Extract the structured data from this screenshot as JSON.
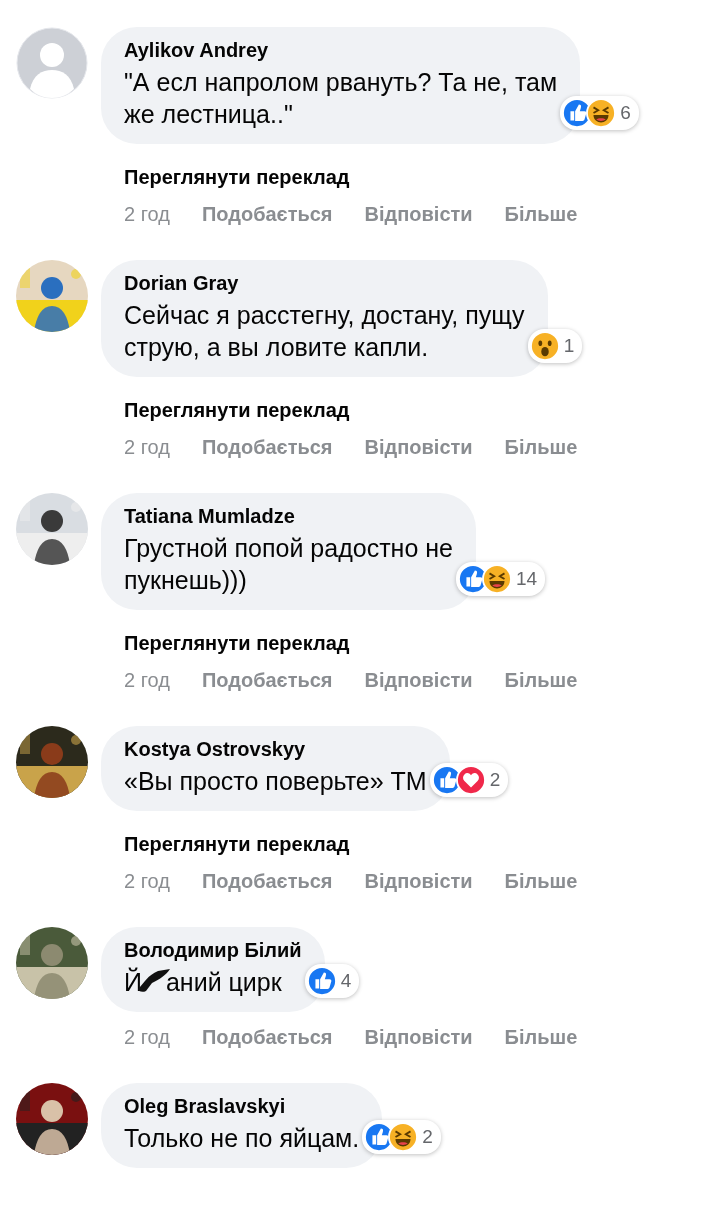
{
  "comments": [
    {
      "author": "Aylikov Andrey",
      "avatar": {
        "kind": "default"
      },
      "text_parts": [
        {
          "kind": "text",
          "text": "\"А есл напролом рвануть? Та не, там\nже лестница..\""
        }
      ],
      "reactions": [
        {
          "kind": "like"
        },
        {
          "kind": "haha"
        }
      ],
      "reaction_count": "6",
      "translate": "Переглянути переклад",
      "actions": [
        "2 год",
        "Подобається",
        "Відповісти",
        "Більше"
      ]
    },
    {
      "author": "Dorian Gray",
      "avatar": {
        "kind": "picture"
      },
      "text_parts": [
        {
          "kind": "text",
          "text": "Сейчас я расстегну, достану, пущу\nструю, а вы ловите капли."
        }
      ],
      "reactions": [
        {
          "kind": "wow"
        }
      ],
      "reaction_count": "1",
      "translate": "Переглянути переклад",
      "actions": [
        "2 год",
        "Подобається",
        "Відповісти",
        "Більше"
      ]
    },
    {
      "author": "Tatiana Mumladze",
      "avatar": {
        "kind": "picture"
      },
      "text_parts": [
        {
          "kind": "text",
          "text": "Грустной попой радостно не\nпукнешь)))"
        }
      ],
      "reactions": [
        {
          "kind": "like"
        },
        {
          "kind": "haha"
        }
      ],
      "reaction_count": "14",
      "translate": "Переглянути переклад",
      "actions": [
        "2 год",
        "Подобається",
        "Відповісти",
        "Більше"
      ]
    },
    {
      "author": "Kostya Ostrovskyy",
      "avatar": {
        "kind": "picture"
      },
      "text_parts": [
        {
          "kind": "text",
          "text": "«Вы просто поверьте» ТМ"
        }
      ],
      "reactions": [
        {
          "kind": "like"
        },
        {
          "kind": "love"
        }
      ],
      "reaction_count": "2",
      "translate": "Переглянути переклад",
      "actions": [
        "2 год",
        "Подобається",
        "Відповісти",
        "Більше"
      ]
    },
    {
      "author": "Володимир Білий",
      "avatar": {
        "kind": "picture"
      },
      "text_parts": [
        {
          "kind": "text",
          "text": "Й"
        },
        {
          "kind": "censor"
        },
        {
          "kind": "text",
          "text": "аний цирк"
        }
      ],
      "reactions": [
        {
          "kind": "like"
        }
      ],
      "reaction_count": "4",
      "actions": [
        "2 год",
        "Подобається",
        "Відповісти",
        "Більше"
      ]
    },
    {
      "author": "Oleg Braslavskyi",
      "avatar": {
        "kind": "picture"
      },
      "text_parts": [
        {
          "kind": "text",
          "text": "Только не по яйцам."
        }
      ],
      "reactions": [
        {
          "kind": "like"
        },
        {
          "kind": "haha"
        }
      ],
      "reaction_count": "2"
    }
  ]
}
